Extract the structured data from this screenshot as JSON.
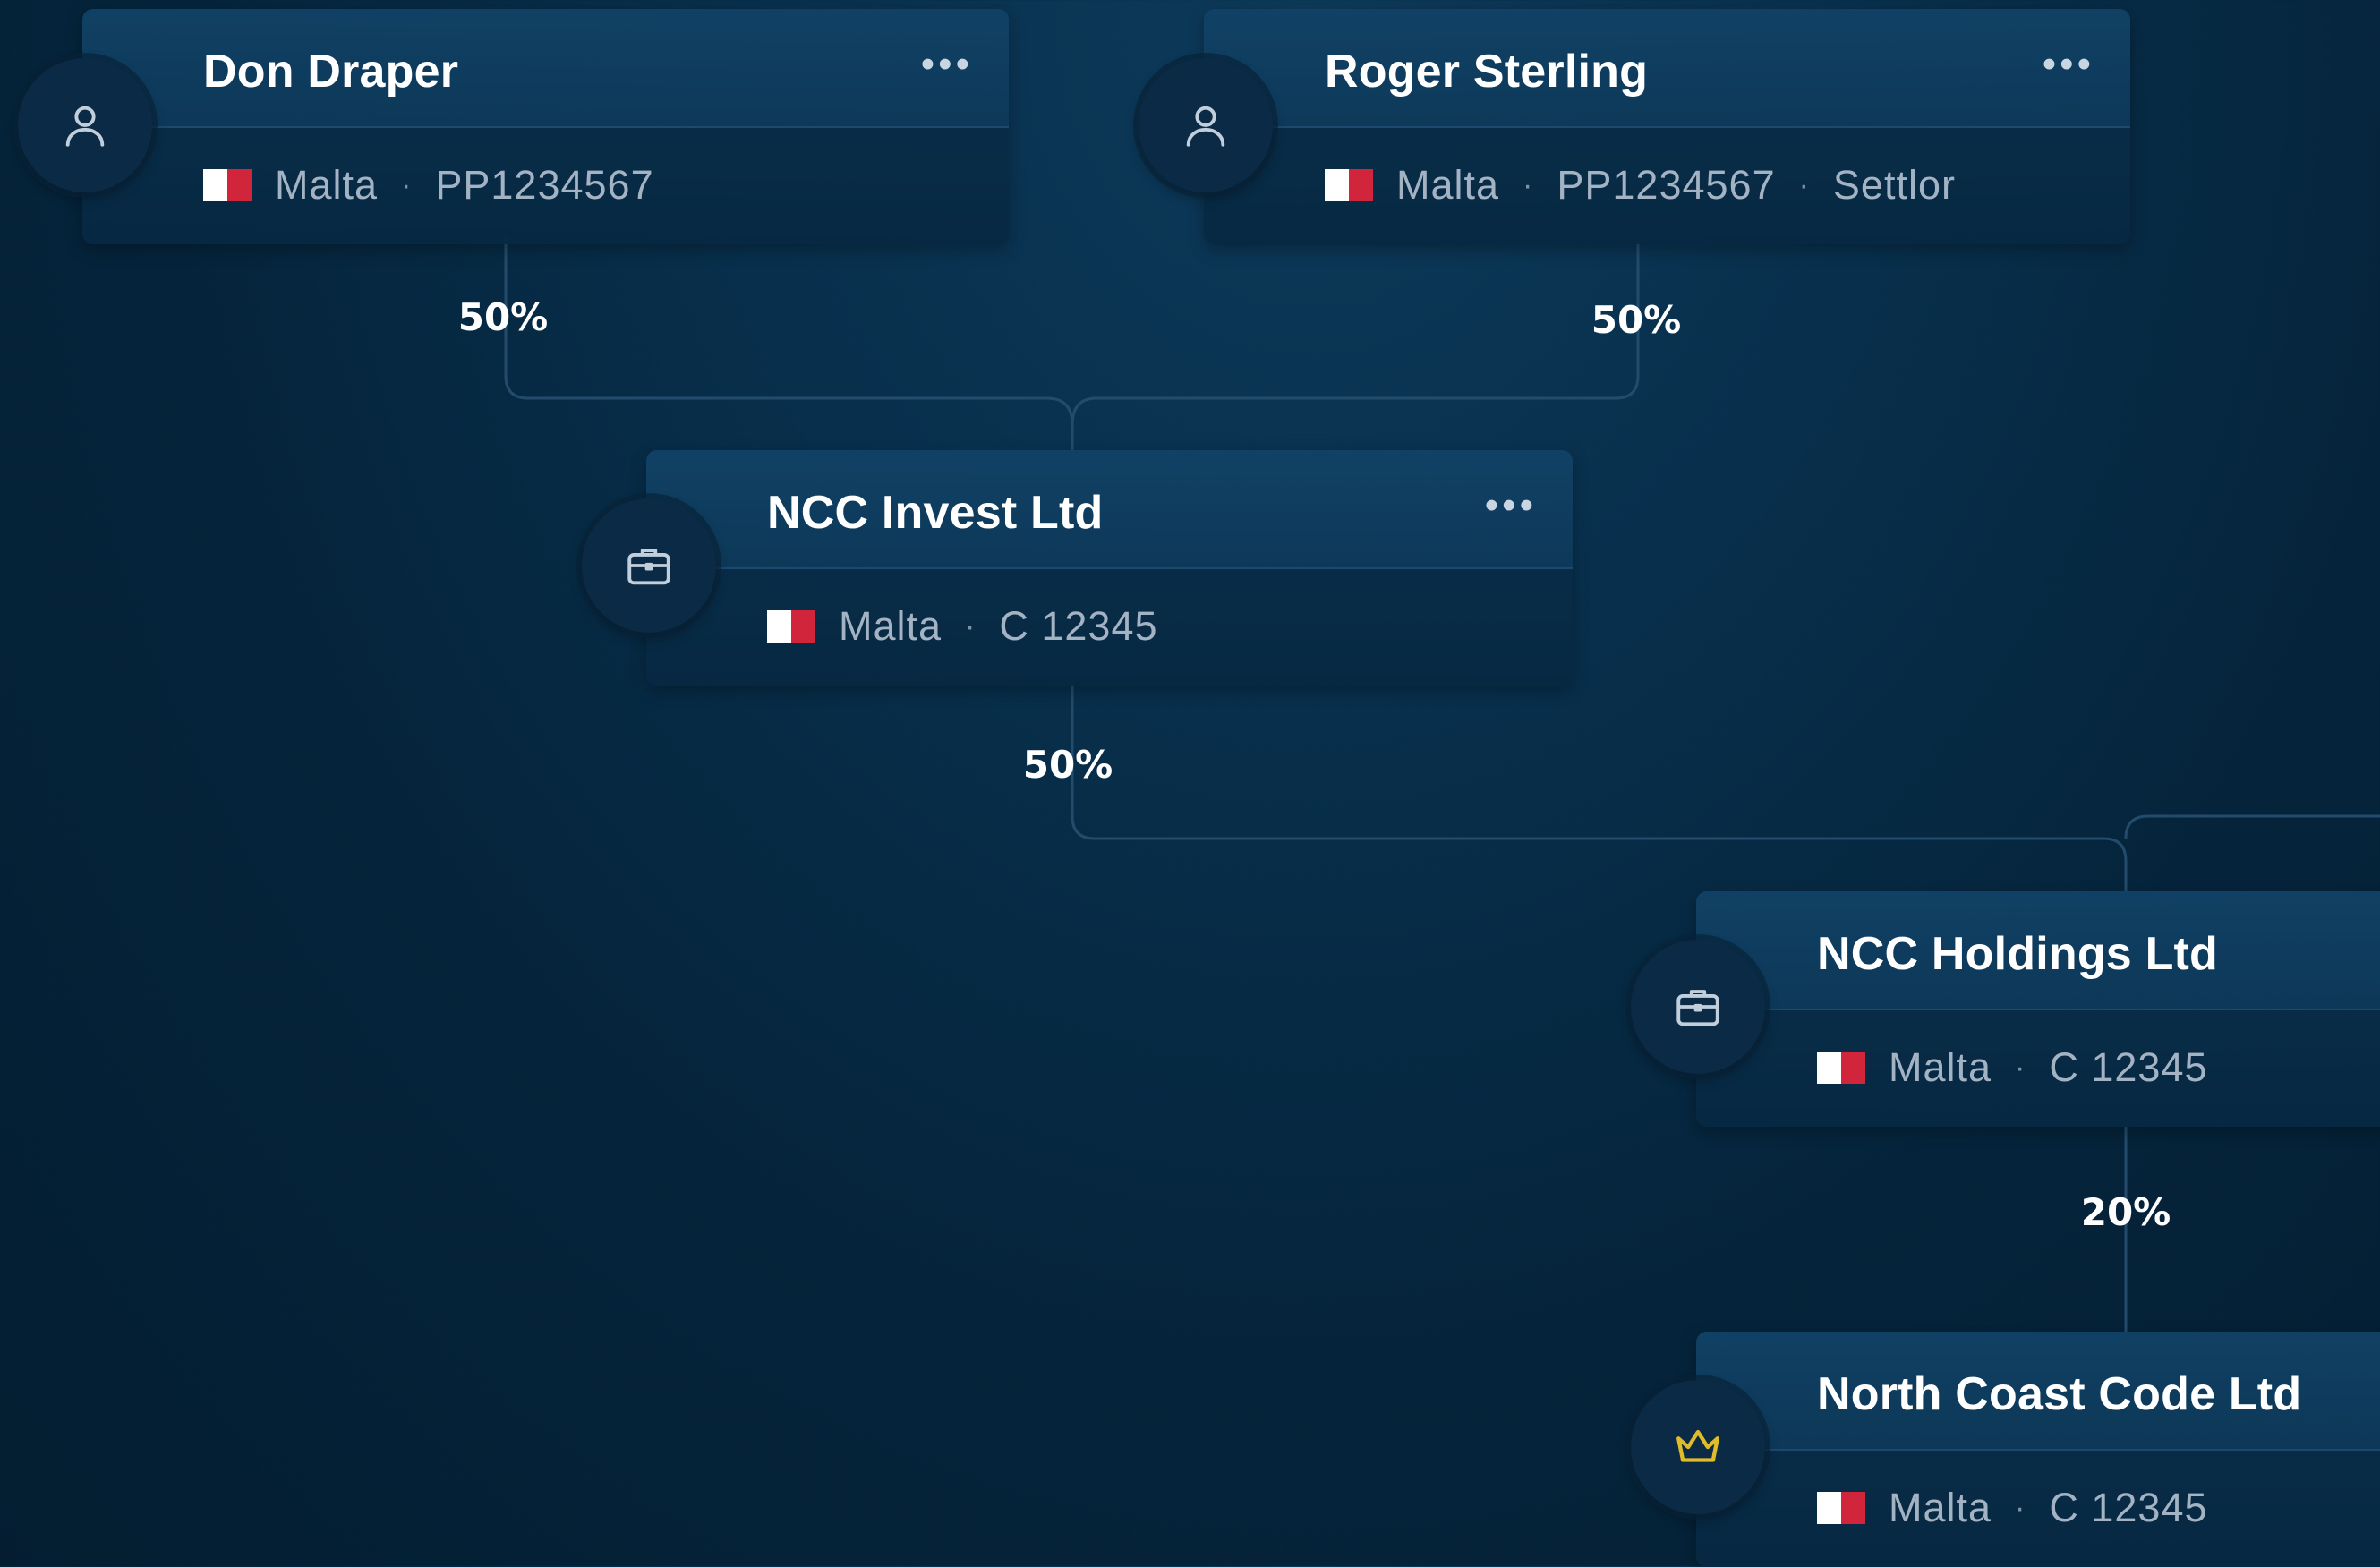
{
  "colors": {
    "connector": "#234c6c",
    "accent_gold": "#e0bb2a",
    "icon_default": "#c1cfdc"
  },
  "entities": [
    {
      "id": "don-draper",
      "name": "Don Draper",
      "kind": "person",
      "icon": "person-icon",
      "country": "Malta",
      "ref": "PP1234567",
      "role": "",
      "show_more": true
    },
    {
      "id": "roger-sterling",
      "name": "Roger Sterling",
      "kind": "person",
      "icon": "person-icon",
      "country": "Malta",
      "ref": "PP1234567",
      "role": "Settlor",
      "show_more": true
    },
    {
      "id": "ncc-invest",
      "name": "NCC Invest Ltd",
      "kind": "company",
      "icon": "briefcase-icon",
      "country": "Malta",
      "ref": "C 12345",
      "role": "",
      "show_more": true
    },
    {
      "id": "ncc-holdings",
      "name": "NCC Holdings Ltd",
      "kind": "company",
      "icon": "briefcase-icon",
      "country": "Malta",
      "ref": "C 12345",
      "role": "",
      "show_more": false
    },
    {
      "id": "north-coast-code",
      "name": "North Coast Code Ltd",
      "kind": "target",
      "icon": "crown-icon",
      "country": "Malta",
      "ref": "C 12345",
      "role": "",
      "show_more": false
    }
  ],
  "ownership": [
    {
      "from": "don-draper",
      "to": "ncc-invest",
      "percent": "50%"
    },
    {
      "from": "roger-sterling",
      "to": "ncc-invest",
      "percent": "50%"
    },
    {
      "from": "ncc-invest",
      "to": "ncc-holdings",
      "percent": "50%"
    },
    {
      "from": "ncc-holdings",
      "to": "north-coast-code",
      "percent": "20%"
    }
  ],
  "more_label": "•••",
  "separator": "·"
}
